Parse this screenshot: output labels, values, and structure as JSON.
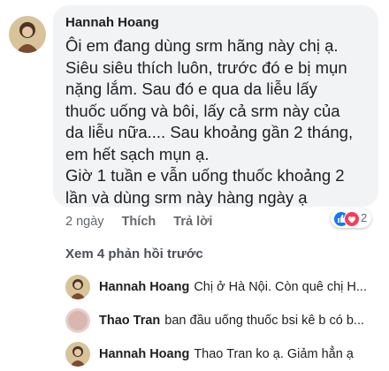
{
  "comment": {
    "author": "Hannah Hoang",
    "lines": [
      "Ôi em đang dùng srm hãng này chị ạ.",
      "Siêu siêu thích luôn, trước đó e bị mụn",
      "nặng lắm. Sau đó e qua da liễu lấy",
      "thuốc uống và bôi, lấy cả srm này của",
      "da liễu nữa.... Sau khoảng gần 2 tháng,",
      "em hết sạch mụn ạ.",
      "Giờ 1 tuần e vẫn uống thuốc khoảng 2",
      "lần và dùng srm này hàng ngày ạ"
    ],
    "time": "2 ngày",
    "like_label": "Thích",
    "reply_label": "Trả lời",
    "reaction_icons": [
      "like-icon",
      "love-icon"
    ],
    "reaction_count": "2"
  },
  "view_previous": "Xem 4 phản hồi trước",
  "replies": [
    {
      "author": "Hannah Hoang",
      "text": "Chị ở Hà Nội. Còn quê chị H..."
    },
    {
      "author": "Thao Tran",
      "text": "ban đầu uống thuốc bsi kê b có b..."
    },
    {
      "author": "Hannah Hoang",
      "text": "Thao Tran ko ạ. Giảm hẳn ạ"
    }
  ],
  "colors": {
    "bubble": "#f2f3f5",
    "like": "#1877f2",
    "love": "#f33e58"
  }
}
